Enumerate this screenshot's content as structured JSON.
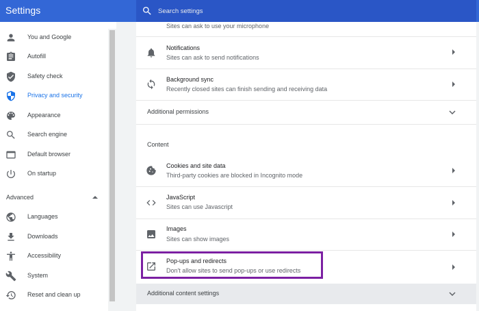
{
  "app": {
    "title": "Settings"
  },
  "search": {
    "placeholder": "Search settings"
  },
  "sidebar": {
    "items": [
      {
        "label": "You and Google",
        "icon": "person-icon"
      },
      {
        "label": "Autofill",
        "icon": "clipboard-icon"
      },
      {
        "label": "Safety check",
        "icon": "shield-check-icon"
      },
      {
        "label": "Privacy and security",
        "icon": "shield-icon",
        "active": true
      },
      {
        "label": "Appearance",
        "icon": "palette-icon"
      },
      {
        "label": "Search engine",
        "icon": "search-icon"
      },
      {
        "label": "Default browser",
        "icon": "browser-icon"
      },
      {
        "label": "On startup",
        "icon": "power-icon"
      }
    ],
    "advanced_label": "Advanced",
    "advanced_items": [
      {
        "label": "Languages",
        "icon": "globe-icon"
      },
      {
        "label": "Downloads",
        "icon": "download-icon"
      },
      {
        "label": "Accessibility",
        "icon": "accessibility-icon"
      },
      {
        "label": "System",
        "icon": "wrench-icon"
      },
      {
        "label": "Reset and clean up",
        "icon": "history-icon"
      }
    ]
  },
  "main": {
    "partial_top_text": "Sites can ask to use your microphone",
    "rows": [
      {
        "title": "Notifications",
        "subtitle": "Sites can ask to send notifications",
        "icon": "bell-icon"
      },
      {
        "title": "Background sync",
        "subtitle": "Recently closed sites can finish sending and receiving data",
        "icon": "sync-icon"
      }
    ],
    "additional_permissions_label": "Additional permissions",
    "content_section_title": "Content",
    "content_rows": [
      {
        "title": "Cookies and site data",
        "subtitle": "Third-party cookies are blocked in Incognito mode",
        "icon": "cookie-icon"
      },
      {
        "title": "JavaScript",
        "subtitle": "Sites can use Javascript",
        "icon": "code-icon"
      },
      {
        "title": "Images",
        "subtitle": "Sites can show images",
        "icon": "image-icon"
      },
      {
        "title": "Pop-ups and redirects",
        "subtitle": "Don't allow sites to send pop-ups or use redirects",
        "icon": "open-in-new-icon"
      }
    ],
    "additional_content_label": "Additional content settings"
  },
  "colors": {
    "header_bg": "#3367d6",
    "search_bg": "#2a56c6",
    "active_nav": "#1a73e8",
    "highlight_border": "#7b1fa2"
  }
}
